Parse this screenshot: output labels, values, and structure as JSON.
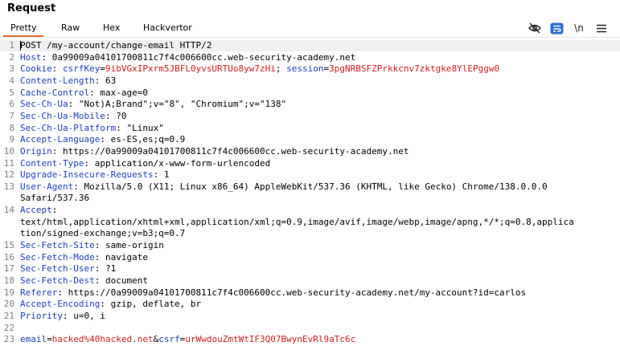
{
  "panel": {
    "title": "Request"
  },
  "tabs": [
    {
      "label": "Pretty",
      "active": true
    },
    {
      "label": "Raw"
    },
    {
      "label": "Hex"
    },
    {
      "label": "Hackvertor"
    }
  ],
  "toolbar": {
    "icons": [
      "eye-slash-icon",
      "wrap-icon",
      "newline-toggle-icon",
      "menu-icon"
    ],
    "newline_label": "\\n"
  },
  "colors": {
    "accent": "#e8673c",
    "header_name": "#1b3fbb",
    "param_value": "#cc1f1f",
    "line_number": "#7f7f7f"
  },
  "request": {
    "lines": [
      {
        "n": "1",
        "parts": [
          {
            "t": "POST /my-account/change-email HTTP/2"
          }
        ]
      },
      {
        "n": "2",
        "parts": [
          {
            "t": "Host",
            "c": "hkey"
          },
          {
            "t": ": 0a99009a04101700811c7f4c006600cc.web-security-academy.net"
          }
        ]
      },
      {
        "n": "3",
        "parts": [
          {
            "t": "Cookie",
            "c": "hkey"
          },
          {
            "t": ": "
          },
          {
            "t": "csrfKey",
            "c": "hkey"
          },
          {
            "t": "="
          },
          {
            "t": "9ibVGxIPxrm5JBFL0yvsURTUo8yw7zHi",
            "c": "red"
          },
          {
            "t": "; "
          },
          {
            "t": "session",
            "c": "hkey"
          },
          {
            "t": "="
          },
          {
            "t": "3pgNRBSFZPrkkcnv7zktgke8YlEPggw0",
            "c": "red"
          }
        ]
      },
      {
        "n": "4",
        "parts": [
          {
            "t": "Content-Length",
            "c": "hkey"
          },
          {
            "t": ": 63"
          }
        ]
      },
      {
        "n": "5",
        "parts": [
          {
            "t": "Cache-Control",
            "c": "hkey"
          },
          {
            "t": ": max-age=0"
          }
        ]
      },
      {
        "n": "6",
        "parts": [
          {
            "t": "Sec-Ch-Ua",
            "c": "hkey"
          },
          {
            "t": ": \"Not)A;Brand\";v=\"8\", \"Chromium\";v=\"138\""
          }
        ]
      },
      {
        "n": "7",
        "parts": [
          {
            "t": "Sec-Ch-Ua-Mobile",
            "c": "hkey"
          },
          {
            "t": ": ?0"
          }
        ]
      },
      {
        "n": "8",
        "parts": [
          {
            "t": "Sec-Ch-Ua-Platform",
            "c": "hkey"
          },
          {
            "t": ": \"Linux\""
          }
        ]
      },
      {
        "n": "9",
        "parts": [
          {
            "t": "Accept-Language",
            "c": "hkey"
          },
          {
            "t": ": es-ES,es;q=0.9"
          }
        ]
      },
      {
        "n": "10",
        "parts": [
          {
            "t": "Origin",
            "c": "hkey"
          },
          {
            "t": ": https://0a99009a04101700811c7f4c006600cc.web-security-academy.net"
          }
        ]
      },
      {
        "n": "11",
        "parts": [
          {
            "t": "Content-Type",
            "c": "hkey"
          },
          {
            "t": ": application/x-www-form-urlencoded"
          }
        ]
      },
      {
        "n": "12",
        "parts": [
          {
            "t": "Upgrade-Insecure-Requests",
            "c": "hkey"
          },
          {
            "t": ": 1"
          }
        ]
      },
      {
        "n": "13",
        "parts": [
          {
            "t": "User-Agent",
            "c": "hkey"
          },
          {
            "t": ": Mozilla/5.0 (X11; Linux x86_64) AppleWebKit/537.36 (KHTML, like Gecko) Chrome/138.0.0.0"
          }
        ]
      },
      {
        "n": "",
        "parts": [
          {
            "t": "Safari/537.36"
          }
        ]
      },
      {
        "n": "14",
        "parts": [
          {
            "t": "Accept",
            "c": "hkey"
          },
          {
            "t": ":"
          }
        ]
      },
      {
        "n": "",
        "parts": [
          {
            "t": "text/html,application/xhtml+xml,application/xml;q=0.9,image/avif,image/webp,image/apng,*/*;q=0.8,applica"
          }
        ]
      },
      {
        "n": "",
        "parts": [
          {
            "t": "tion/signed-exchange;v=b3;q=0.7"
          }
        ]
      },
      {
        "n": "15",
        "parts": [
          {
            "t": "Sec-Fetch-Site",
            "c": "hkey"
          },
          {
            "t": ": same-origin"
          }
        ]
      },
      {
        "n": "16",
        "parts": [
          {
            "t": "Sec-Fetch-Mode",
            "c": "hkey"
          },
          {
            "t": ": navigate"
          }
        ]
      },
      {
        "n": "17",
        "parts": [
          {
            "t": "Sec-Fetch-User",
            "c": "hkey"
          },
          {
            "t": ": ?1"
          }
        ]
      },
      {
        "n": "18",
        "parts": [
          {
            "t": "Sec-Fetch-Dest",
            "c": "hkey"
          },
          {
            "t": ": document"
          }
        ]
      },
      {
        "n": "19",
        "parts": [
          {
            "t": "Referer",
            "c": "hkey"
          },
          {
            "t": ": https://0a99009a04101700811c7f4c006600cc.web-security-academy.net/my-account?id=carlos"
          }
        ]
      },
      {
        "n": "20",
        "parts": [
          {
            "t": "Accept-Encoding",
            "c": "hkey"
          },
          {
            "t": ": gzip, deflate, br"
          }
        ]
      },
      {
        "n": "21",
        "parts": [
          {
            "t": "Priority",
            "c": "hkey"
          },
          {
            "t": ": u=0, i"
          }
        ]
      },
      {
        "n": "22",
        "parts": []
      },
      {
        "n": "23",
        "parts": [
          {
            "t": "email",
            "c": "hkey"
          },
          {
            "t": "="
          },
          {
            "t": "hacked%40hacked.net",
            "c": "red"
          },
          {
            "t": "&"
          },
          {
            "t": "csrf",
            "c": "hkey"
          },
          {
            "t": "="
          },
          {
            "t": "urWwdouZmtWtIF3Q07BwynEvRl9aTc6c",
            "c": "red"
          }
        ]
      }
    ]
  }
}
